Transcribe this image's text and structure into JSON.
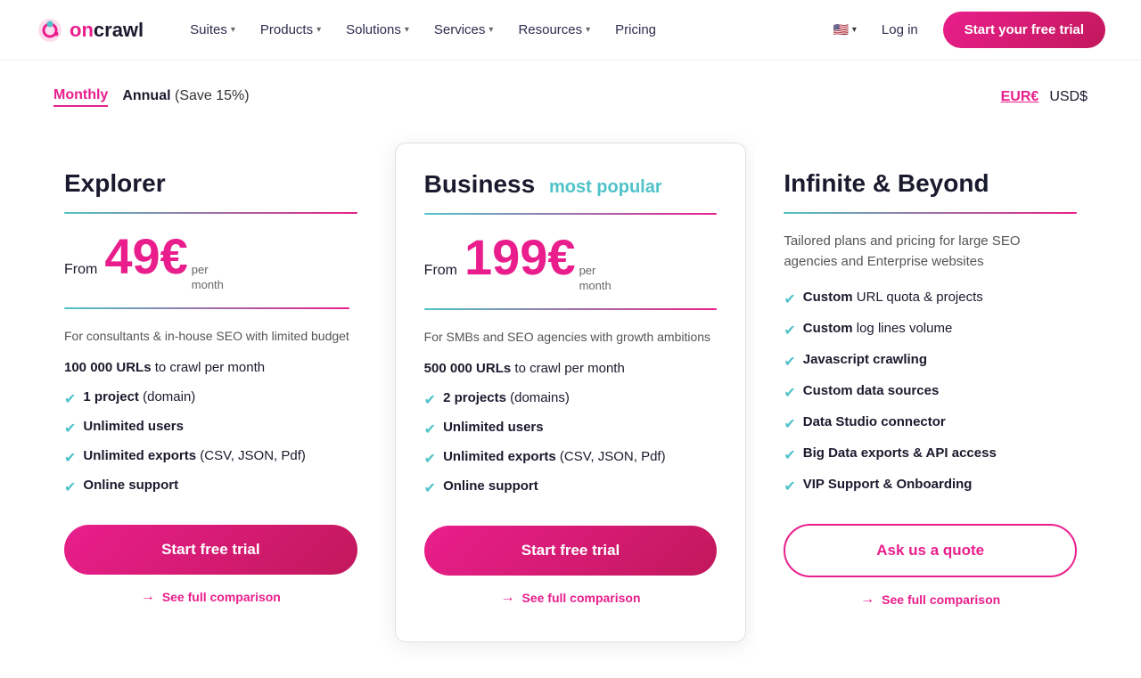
{
  "logo": {
    "text": "oncrawl",
    "alt": "OnCrawl Logo"
  },
  "navbar": {
    "items": [
      {
        "label": "Suites",
        "has_dropdown": true
      },
      {
        "label": "Products",
        "has_dropdown": true
      },
      {
        "label": "Solutions",
        "has_dropdown": true
      },
      {
        "label": "Services",
        "has_dropdown": true
      },
      {
        "label": "Resources",
        "has_dropdown": true
      },
      {
        "label": "Pricing",
        "has_dropdown": false
      }
    ],
    "login_label": "Log in",
    "cta_label": "Start your free trial",
    "language": "EN",
    "flag": "🇺🇸"
  },
  "billing": {
    "monthly_label": "Monthly",
    "annual_label": "Annual",
    "annual_save": "(Save 15%)",
    "active": "monthly",
    "currencies": [
      "EUR€",
      "USD$"
    ],
    "active_currency": "EUR€"
  },
  "plans": [
    {
      "id": "explorer",
      "title": "Explorer",
      "popular": false,
      "price_from": "From",
      "price": "49€",
      "price_per": "per",
      "price_period": "month",
      "description": "For consultants & in-house SEO with limited budget",
      "url_text": "100 000 URLs",
      "url_desc": "to crawl per month",
      "features": [
        {
          "bold": "1 project",
          "normal": " (domain)"
        },
        {
          "bold": "Unlimited users",
          "normal": ""
        },
        {
          "bold": "Unlimited exports",
          "normal": " (CSV, JSON, Pdf)"
        },
        {
          "bold": "Online support",
          "normal": ""
        }
      ],
      "btn_label": "Start free trial",
      "btn_type": "primary",
      "comparison_label": "See full comparison"
    },
    {
      "id": "business",
      "title": "Business",
      "popular": true,
      "popular_tag": "most popular",
      "price_from": "From",
      "price": "199€",
      "price_per": "per",
      "price_period": "month",
      "description": "For SMBs and SEO agencies with growth ambitions",
      "url_text": "500 000 URLs",
      "url_desc": "to crawl per month",
      "features": [
        {
          "bold": "2 projects",
          "normal": " (domains)"
        },
        {
          "bold": "Unlimited users",
          "normal": ""
        },
        {
          "bold": "Unlimited exports",
          "normal": " (CSV, JSON, Pdf)"
        },
        {
          "bold": "Online support",
          "normal": ""
        }
      ],
      "btn_label": "Start free trial",
      "btn_type": "primary",
      "comparison_label": "See full comparison"
    },
    {
      "id": "infinite",
      "title": "Infinite & Beyond",
      "popular": false,
      "description": "Tailored plans and pricing for large SEO agencies and Enterprise websites",
      "features": [
        {
          "bold": "Custom",
          "normal": " URL quota & projects"
        },
        {
          "bold": "Custom",
          "normal": " log lines volume"
        },
        {
          "bold": "Javascript crawling",
          "normal": ""
        },
        {
          "bold": "Custom data sources",
          "normal": ""
        },
        {
          "bold": "Data Studio connector",
          "normal": ""
        },
        {
          "bold": "Big Data exports & API access",
          "normal": ""
        },
        {
          "bold": "VIP Support & Onboarding",
          "normal": ""
        }
      ],
      "btn_label": "Ask us a quote",
      "btn_type": "outline",
      "comparison_label": "See full comparison"
    }
  ]
}
